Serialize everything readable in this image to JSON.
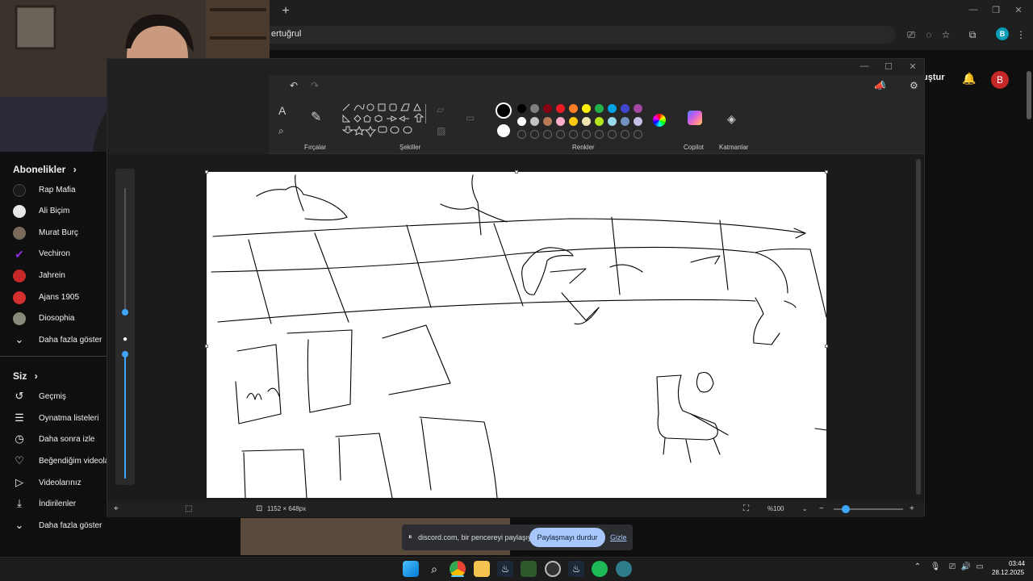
{
  "browser": {
    "new_tab": "+",
    "address_fragment": "ertuğrul",
    "profile_letter": "B"
  },
  "youtube": {
    "create_label": "luştur",
    "avatar_letter": "B",
    "subscriptions_header": "Abonelikler",
    "subscriptions": [
      {
        "label": "Rap Mafia",
        "color": "#1a1a1a"
      },
      {
        "label": "Ali Biçim",
        "color": "#e6e6e6"
      },
      {
        "label": "Murat Burç",
        "color": "#7a6a5a"
      },
      {
        "label": "Vechiron",
        "color": "#6a1fa3"
      },
      {
        "label": "Jahrein",
        "color": "#c62828"
      },
      {
        "label": "Ajans 1905",
        "color": "#d32f2f"
      },
      {
        "label": "Diosophia",
        "color": "#8a8a7a"
      }
    ],
    "show_more_1": "Daha fazla göster",
    "you_header": "Siz",
    "you_items": [
      {
        "label": "Geçmiş",
        "icon": "history-icon",
        "glyph": "↺"
      },
      {
        "label": "Oynatma listeleri",
        "icon": "playlist-icon",
        "glyph": "☰"
      },
      {
        "label": "Daha sonra izle",
        "icon": "clock-icon",
        "glyph": "◷"
      },
      {
        "label": "Beğendiğim videolar",
        "icon": "thumbs-up-icon",
        "glyph": "👍"
      },
      {
        "label": "Videolarınız",
        "icon": "video-icon",
        "glyph": "▶"
      },
      {
        "label": "İndirilenler",
        "icon": "download-icon",
        "glyph": "⤓"
      }
    ],
    "show_more_2": "Daha fazla göster"
  },
  "paint": {
    "groups": {
      "brushes": "Fırçalar",
      "shapes": "Şekiller",
      "colors": "Renkler",
      "copilot": "Copilot",
      "layers": "Katmanlar"
    },
    "palette_row1": [
      "#000000",
      "#7f7f7f",
      "#880015",
      "#ed1c24",
      "#ff7f27",
      "#fff200",
      "#22b14c",
      "#00a2e8",
      "#3f48cc",
      "#a349a4"
    ],
    "palette_row2": [
      "#ffffff",
      "#c3c3c3",
      "#b97a57",
      "#ffaec9",
      "#ffc90e",
      "#efe4b0",
      "#b5e61d",
      "#99d9ea",
      "#7092be",
      "#c8bfe7"
    ],
    "canvas_size": "1152 × 648px",
    "zoom": "%100"
  },
  "share": {
    "text": "discord.com, bir pencereyi paylaşıyor.",
    "stop_label": "Paylaşmayı durdur",
    "hide_label": "Gizle"
  },
  "taskbar": {
    "time": "03:44",
    "date": "28.12.2025"
  }
}
